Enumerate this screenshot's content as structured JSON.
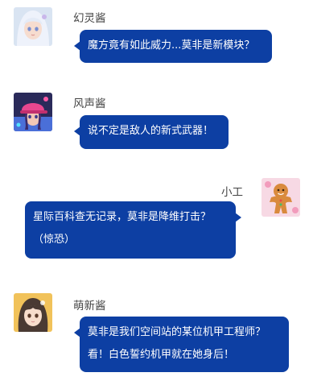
{
  "messages": [
    {
      "sender": "幻灵酱",
      "side": "left",
      "avatar_icon": "anime-girl-white-hair-avatar",
      "lines": [
        "魔方竟有如此威力...莫非是新模块？"
      ]
    },
    {
      "sender": "风声酱",
      "side": "left",
      "avatar_icon": "anime-girl-pink-cap-avatar",
      "lines": [
        "说不定是敌人的新式武器！"
      ]
    },
    {
      "sender": "小工",
      "side": "right",
      "avatar_icon": "gingerbread-man-avatar",
      "lines": [
        "星际百科查无记录，莫非是降维打击？",
        "（惊恐）"
      ]
    },
    {
      "sender": "萌新酱",
      "side": "left",
      "avatar_icon": "anime-girl-dark-hair-avatar",
      "lines": [
        "莫非是我们空间站的某位机甲工程师？",
        "看！白色誓约机甲就在她身后！"
      ]
    }
  ],
  "colors": {
    "bubble": "#0d3fa3",
    "bubble_text": "#ffffff",
    "name_text": "#444444"
  }
}
